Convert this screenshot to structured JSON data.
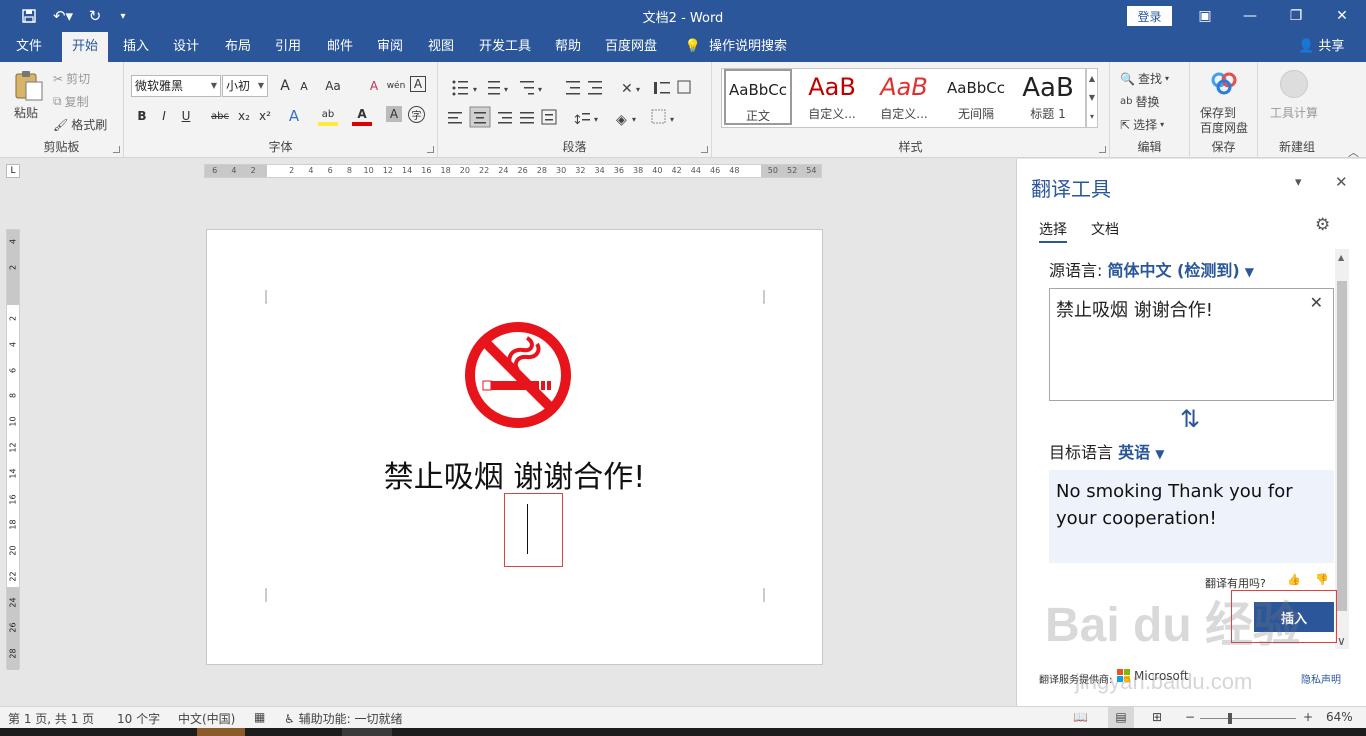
{
  "titlebar": {
    "title": "文档2  -  Word",
    "login": "登录",
    "qa_save": "💾",
    "qa_undo": "↶▾",
    "qa_redo": "↻",
    "qa_custom": "▾",
    "btn_ribbon": "▣",
    "btn_min": "—",
    "btn_max": "❐",
    "btn_close": "✕"
  },
  "menu": {
    "tabs": [
      "文件",
      "开始",
      "插入",
      "设计",
      "布局",
      "引用",
      "邮件",
      "审阅",
      "视图",
      "开发工具",
      "帮助",
      "百度网盘",
      "操作说明搜索"
    ],
    "active_tab": "开始",
    "share": "共享"
  },
  "ribbon": {
    "clipboard": {
      "paste": "粘贴",
      "cut": "剪切",
      "copy": "复制",
      "format_painter": "格式刷",
      "label": "剪贴板"
    },
    "font": {
      "font_name": "微软雅黑",
      "font_size": "小初",
      "label": "字体",
      "bold": "B",
      "italic": "I",
      "underline": "U",
      "strike": "abc",
      "subscript": "x₂",
      "superscript": "x²",
      "grow": "A",
      "shrink": "A",
      "case": "Aa",
      "clear": "A",
      "phonetic": "wén",
      "border_char": "A",
      "effects": "A",
      "highlight": "ab",
      "font_color": "A",
      "shading": "A",
      "enclose": "字"
    },
    "paragraph": {
      "label": "段落"
    },
    "styles": {
      "label": "样式",
      "items": [
        {
          "preview": "AaBbCc",
          "name": "正文"
        },
        {
          "preview": "AaB",
          "name": "自定义..."
        },
        {
          "preview": "AaB",
          "name": "自定义..."
        },
        {
          "preview": "AaBbCc",
          "name": "无间隔"
        },
        {
          "preview": "AaB",
          "name": "标题 1"
        }
      ]
    },
    "editing": {
      "find": "查找",
      "replace": "替换",
      "select": "选择",
      "label": "编辑"
    },
    "save": {
      "button": "保存到\n百度网盘",
      "line1": "保存到",
      "line2": "百度网盘",
      "label": "保存"
    },
    "newgroup": {
      "tool": "工具计算",
      "label": "新建组"
    }
  },
  "ruler": {
    "h_ticks": [
      "6",
      "4",
      "2",
      "",
      "2",
      "4",
      "6",
      "8",
      "10",
      "12",
      "14",
      "16",
      "18",
      "20",
      "22",
      "24",
      "26",
      "28",
      "30",
      "32",
      "34",
      "36",
      "38",
      "40",
      "42",
      "44",
      "46",
      "48",
      "",
      "50",
      "52",
      "54"
    ],
    "v_ticks": [
      "4",
      "2",
      "",
      "2",
      "4",
      "6",
      "8",
      "10",
      "12",
      "14",
      "16",
      "18",
      "20",
      "22",
      "24",
      "26",
      "28"
    ],
    "box": "L"
  },
  "document": {
    "main_text": "禁止吸烟  谢谢合作!"
  },
  "pane": {
    "title": "翻译工具",
    "tabs": [
      "选择",
      "文档"
    ],
    "active_tab": "选择",
    "source_label": "源语言: ",
    "source_lang": "简体中文 (检测到)",
    "source_text": "禁止吸烟 谢谢合作!",
    "target_label": "目标语言  ",
    "target_lang": "英语",
    "target_text": "No smoking Thank you for your cooperation!",
    "helpful": "翻译有用吗?",
    "insert": "插入",
    "provider": "翻译服务提供商:",
    "provider_name": "Microsoft",
    "privacy": "隐私声明",
    "swap_icon": "⇅",
    "thumb_up": "👍",
    "thumb_down": "👎",
    "settings_icon": "⚙",
    "dropdown": "▾",
    "close": "✕"
  },
  "status": {
    "page": "第 1 页, 共 1 页",
    "words": "10 个字",
    "lang": "中文(中国)",
    "accessibility": "辅助功能: 一切就绪",
    "zoom": "64%"
  },
  "watermark": {
    "main": "Bai du 经验",
    "sub": "jingyan.baidu.com"
  }
}
